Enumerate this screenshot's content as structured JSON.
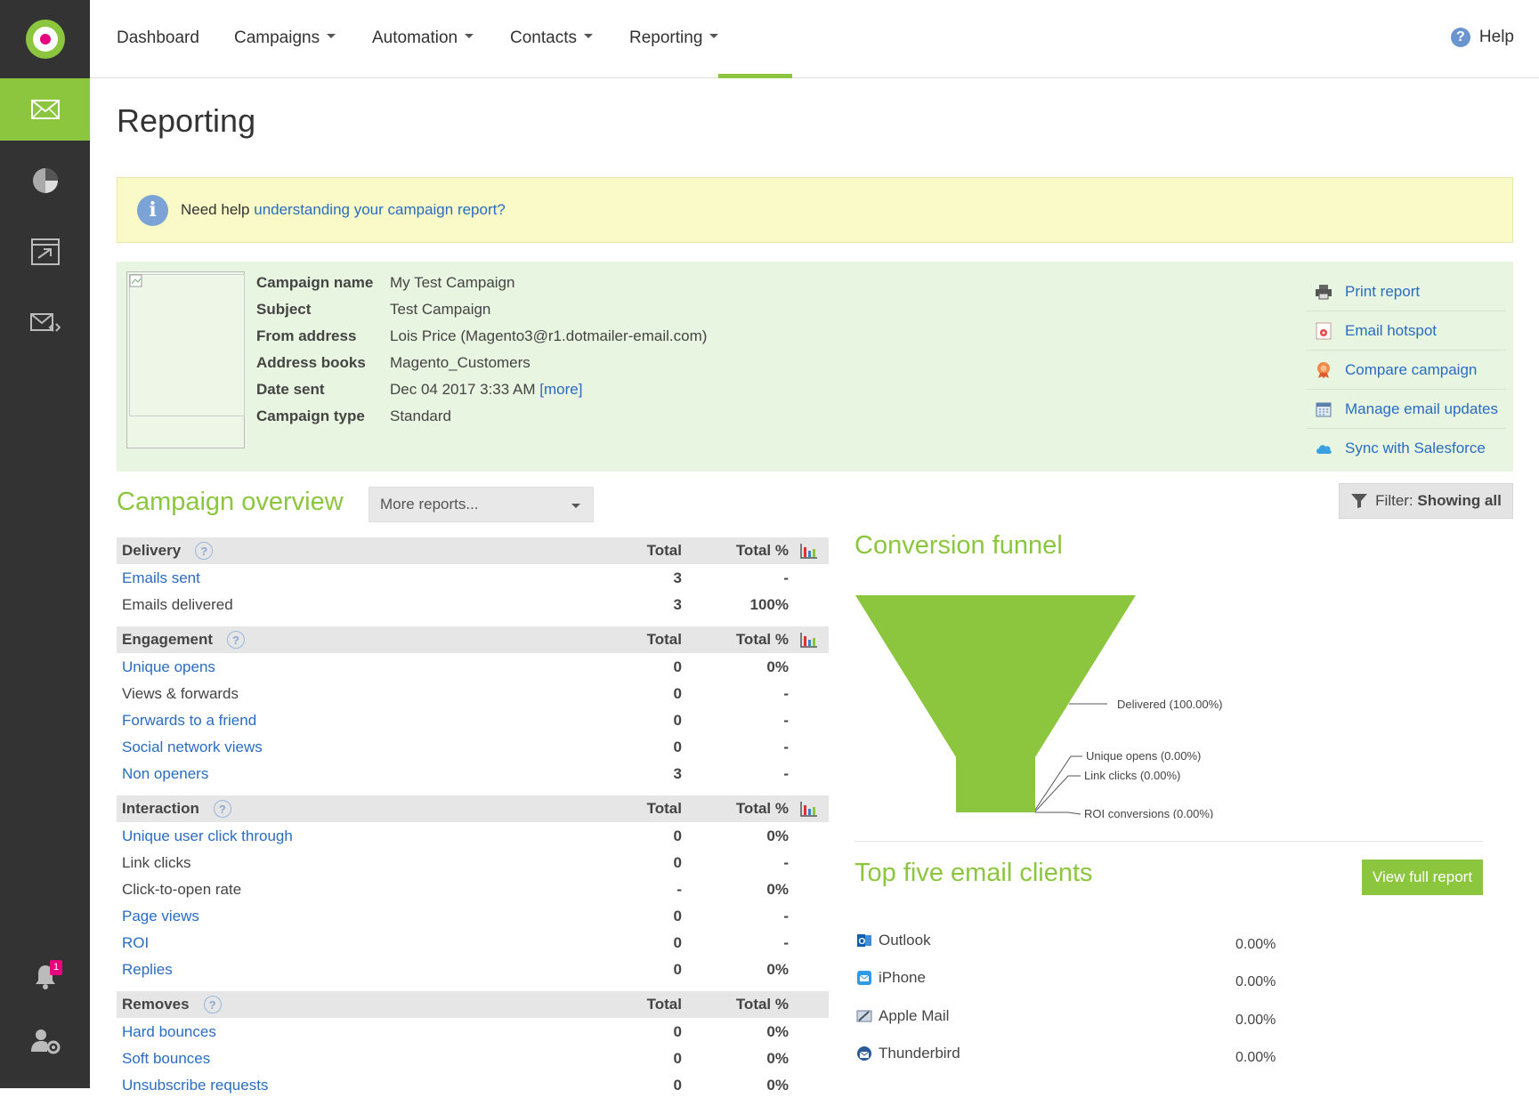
{
  "nav": {
    "items": [
      "Dashboard",
      "Campaigns",
      "Automation",
      "Contacts",
      "Reporting"
    ],
    "help": "Help"
  },
  "sidebar": {
    "items": [
      "email-icon",
      "pie-chart-icon",
      "automation-icon",
      "template-icon"
    ],
    "notification_count": "1"
  },
  "page": {
    "title": "Reporting"
  },
  "info": {
    "prefix": "Need help ",
    "link": "understanding your campaign report?"
  },
  "campaign": {
    "details": [
      {
        "label": "Campaign name",
        "value": "My Test Campaign"
      },
      {
        "label": "Subject",
        "value": "Test Campaign"
      },
      {
        "label": "From address",
        "value": "Lois Price (Magento3@r1.dotmailer-email.com)"
      },
      {
        "label": "Address books",
        "value": "Magento_Customers"
      },
      {
        "label": "Date sent",
        "value": "Dec 04 2017 3:33 AM"
      },
      {
        "label": "Campaign type",
        "value": "Standard"
      }
    ],
    "more_link": "[more]",
    "actions": [
      "Print report",
      "Email hotspot",
      "Compare campaign",
      "Manage email updates",
      "Sync with Salesforce"
    ]
  },
  "overview": {
    "title": "Campaign overview",
    "more_reports": "More reports...",
    "filter_prefix": "Filter: ",
    "filter_value": "Showing all",
    "col_total": "Total",
    "col_pct": "Total %",
    "sections": [
      {
        "name": "Delivery",
        "chart": true,
        "rows": [
          {
            "label": "Emails sent",
            "link": true,
            "total": "3",
            "pct": "-"
          },
          {
            "label": "Emails delivered",
            "link": false,
            "total": "3",
            "pct": "100%"
          }
        ]
      },
      {
        "name": "Engagement",
        "chart": true,
        "rows": [
          {
            "label": "Unique opens",
            "link": true,
            "total": "0",
            "pct": "0%"
          },
          {
            "label": "Views & forwards",
            "link": false,
            "total": "0",
            "pct": "-"
          },
          {
            "label": "Forwards to a friend",
            "link": true,
            "total": "0",
            "pct": "-"
          },
          {
            "label": "Social network views",
            "link": true,
            "total": "0",
            "pct": "-"
          },
          {
            "label": "Non openers",
            "link": true,
            "total": "3",
            "pct": "-"
          }
        ]
      },
      {
        "name": "Interaction",
        "chart": true,
        "rows": [
          {
            "label": "Unique user click through",
            "link": true,
            "total": "0",
            "pct": "0%"
          },
          {
            "label": "Link clicks",
            "link": false,
            "total": "0",
            "pct": "-"
          },
          {
            "label": "Click-to-open rate",
            "link": false,
            "total": "-",
            "pct": "0%"
          },
          {
            "label": "Page views",
            "link": true,
            "total": "0",
            "pct": "-"
          },
          {
            "label": "ROI",
            "link": true,
            "total": "0",
            "pct": "-"
          },
          {
            "label": "Replies",
            "link": true,
            "total": "0",
            "pct": "0%"
          }
        ]
      },
      {
        "name": "Removes",
        "chart": false,
        "rows": [
          {
            "label": "Hard bounces",
            "link": true,
            "total": "0",
            "pct": "0%"
          },
          {
            "label": "Soft bounces",
            "link": true,
            "total": "0",
            "pct": "0%"
          },
          {
            "label": "Unsubscribe requests",
            "link": true,
            "total": "0",
            "pct": "0%"
          }
        ]
      }
    ]
  },
  "funnel": {
    "title": "Conversion funnel",
    "labels": [
      "Delivered (100.00%)",
      "Unique opens (0.00%)",
      "Link clicks (0.00%)",
      "ROI conversions (0.00%)"
    ],
    "color": "#8cc63f"
  },
  "clients": {
    "title": "Top five email clients",
    "view_full": "View full report",
    "items": [
      {
        "name": "Outlook",
        "pct": "0.00%",
        "icon": "outlook-icon"
      },
      {
        "name": "iPhone",
        "pct": "0.00%",
        "icon": "iphone-icon"
      },
      {
        "name": "Apple Mail",
        "pct": "0.00%",
        "icon": "apple-mail-icon"
      },
      {
        "name": "Thunderbird",
        "pct": "0.00%",
        "icon": "thunderbird-icon"
      }
    ]
  },
  "colors": {
    "accent": "#8cc63f",
    "link": "#2a6cc0",
    "sidebar": "#333333",
    "badge": "#e6007e"
  }
}
